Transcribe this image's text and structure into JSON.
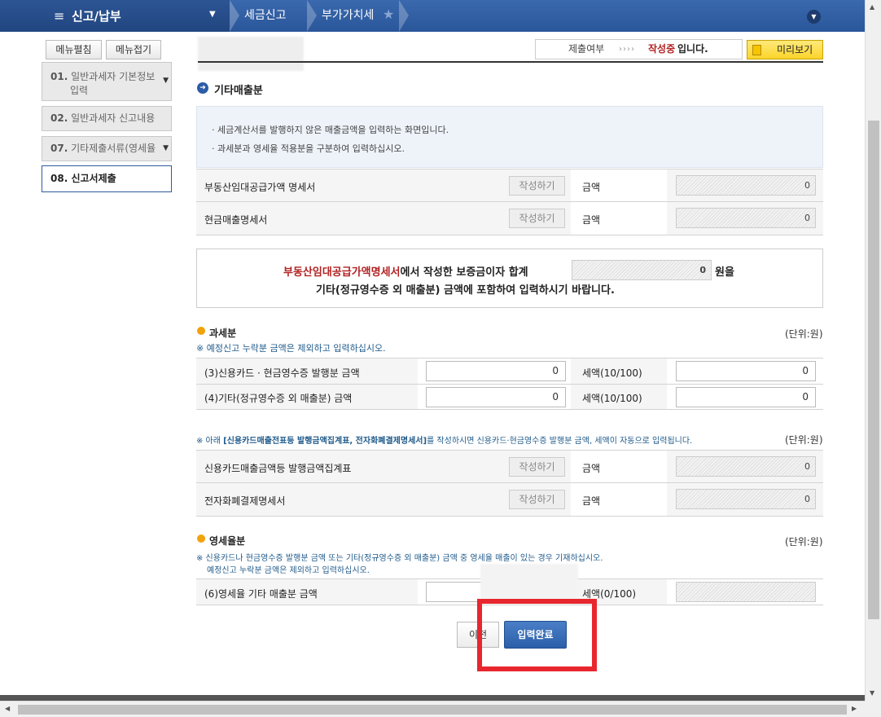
{
  "topbar": {
    "menu_title": "신고/납부",
    "crumb1": "세금신고",
    "crumb2": "부가가치세"
  },
  "sidebar": {
    "expand_label": "메뉴펼침",
    "collapse_label": "메뉴접기",
    "steps": [
      {
        "num": "01.",
        "line1": "일반과세자 기본정보",
        "line2": "입력"
      },
      {
        "num": "02.",
        "line1": "일반과세자 신고내용"
      },
      {
        "num": "07.",
        "line1": "기타제출서류(영세율"
      },
      {
        "num": "08.",
        "line1": "신고서제출"
      }
    ]
  },
  "status": {
    "label": "제출여부",
    "arrows": "››››",
    "state": "작성중",
    "suffix": "입니다."
  },
  "preview_label": "미리보기",
  "section_title": "기타매출분",
  "info": [
    "· 세금계산서를 발행하지 않은 매출금액을 입력하는 화면입니다.",
    "· 과세분과 영세율 적용분을 구분하여 입력하십시오."
  ],
  "write_btn": "작성하기",
  "amount_label": "금액",
  "rows_top": [
    {
      "label": "부동산임대공급가액 명세서",
      "amount": "0"
    },
    {
      "label": "현금매출명세서",
      "amount": "0"
    }
  ],
  "notice": {
    "red": "부동산임대공급가액명세서",
    "text1": "에서 작성한 보증금이자 합계",
    "value": "0",
    "text2": "원을",
    "line2": "기타(정규영수증 외 매출분) 금액에 포함하여 입력하시기 바랍니다."
  },
  "taxable": {
    "title": "과세분",
    "unit": "(단위:원)",
    "note": "※ 예정신고 누락분 금액은 제외하고 입력하십시오.",
    "rows": [
      {
        "label": "(3)신용카드 · 현금영수증 발행분 금액",
        "value": "0",
        "tax_label": "세액(10/100)",
        "tax": "0"
      },
      {
        "label": "(4)기타(정규영수증 외 매출분) 금액",
        "value": "0",
        "tax_label": "세액(10/100)",
        "tax": "0"
      }
    ]
  },
  "card_note": {
    "prefix": "※ 아래 ",
    "bold": "[신용카드매출전표등 발행금액집계표, 전자화폐결제명세서]",
    "suffix": "를 작성하시면 신용카드·현금영수증 발행분 금액, 세액이 자동으로 입력됩니다.",
    "unit": "(단위:원)"
  },
  "rows_card": [
    {
      "label": "신용카드매출금액등 발행금액집계표",
      "amount": "0"
    },
    {
      "label": "전자화폐결제명세서",
      "amount": "0"
    }
  ],
  "zero_rate": {
    "title": "영세율분",
    "unit": "(단위:원)",
    "note1": "※ 신용카드나 현금영수증 발행분 금액 또는 기타(정규영수증 외 매출분) 금액 중 영세율 매출이 있는 경우 기재하십시오.",
    "note2": "예정신고 누락분 금액은 제외하고 입력하십시오.",
    "row_label": "(6)영세율 기타 매출분 금액",
    "tax_label": "세액(0/100)"
  },
  "btn_prev": "이전",
  "btn_done": "입력완료"
}
